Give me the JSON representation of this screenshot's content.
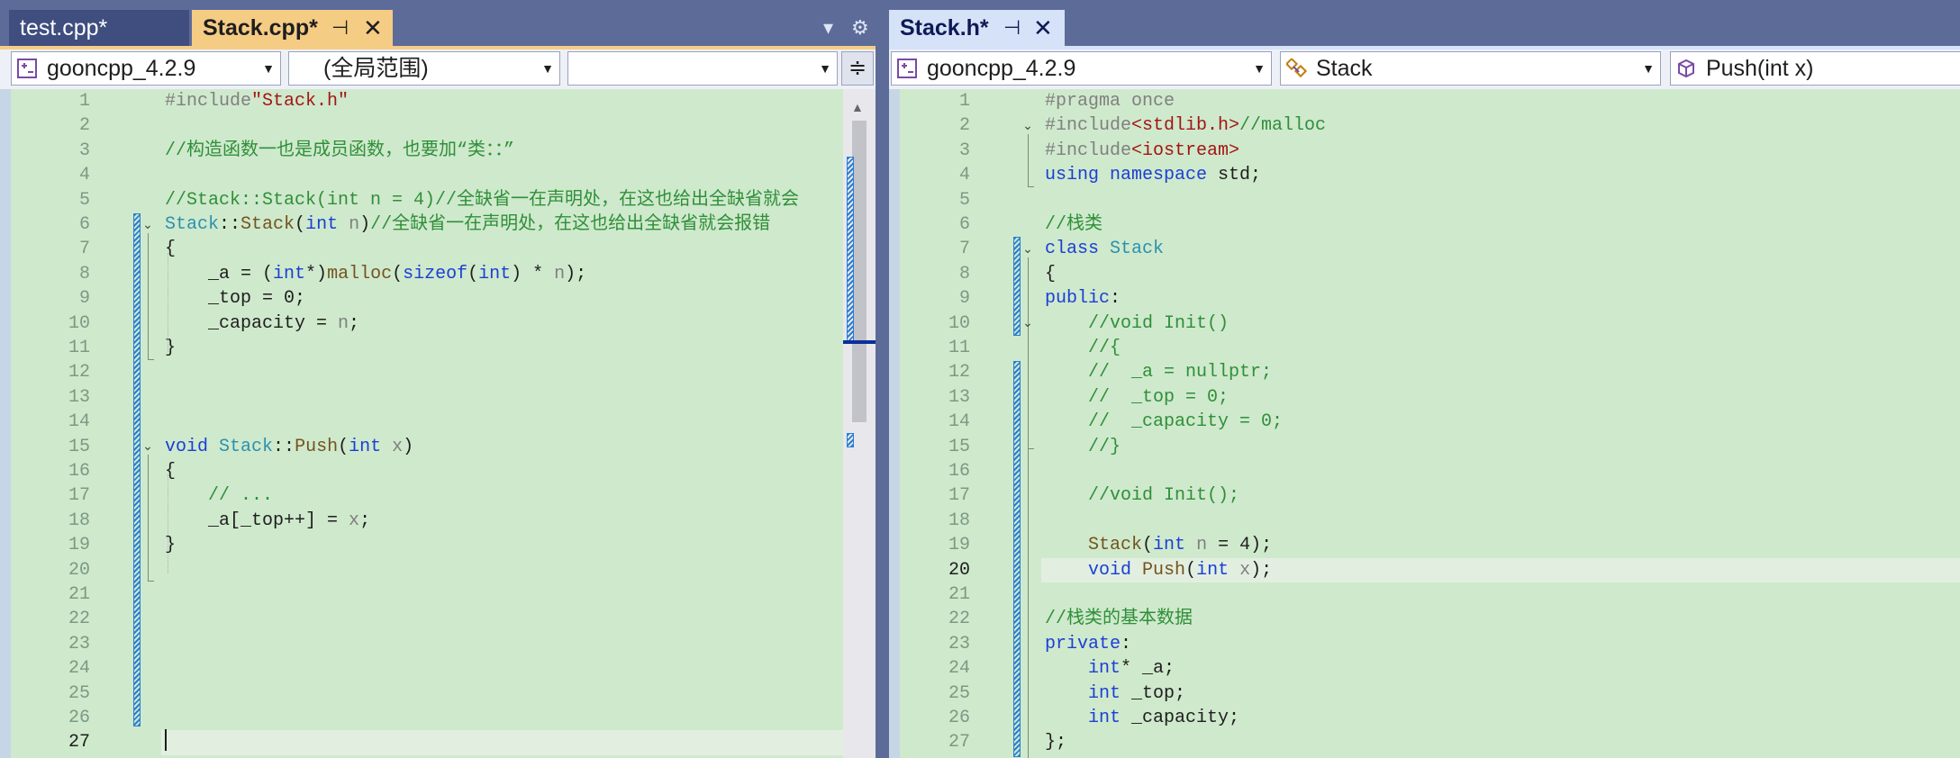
{
  "left": {
    "tabs": [
      {
        "label": "test.cpp*"
      },
      {
        "label": "Stack.cpp*",
        "active": true
      }
    ],
    "tab_pin": "⊣",
    "tab_close": "✕",
    "dropdown_icon": "chevron-down-icon",
    "settings_icon": "gear-icon",
    "nav": {
      "project": "gooncpp_4.2.9",
      "scope": "(全局范围)",
      "member": ""
    },
    "lines": [
      {
        "n": "1",
        "code": [
          [
            "pp",
            "#include"
          ],
          [
            "st",
            "\"Stack.h\""
          ]
        ]
      },
      {
        "n": "2",
        "code": []
      },
      {
        "n": "3",
        "code": [
          [
            "cm",
            "//构造函数一也是成员函数，也要加“类：：”"
          ]
        ]
      },
      {
        "n": "4",
        "code": []
      },
      {
        "n": "5",
        "code": [
          [
            "cm",
            "//Stack::Stack(int n = 4)//全缺省一在声明处，在这也给出全缺省就会"
          ]
        ]
      },
      {
        "n": "6",
        "code": [
          [
            "ty",
            "Stack"
          ],
          [
            "",
            "::"
          ],
          [
            "fn",
            "Stack"
          ],
          [
            "",
            "("
          ],
          [
            "kw",
            "int"
          ],
          [
            "",
            ""
          ],
          [
            "pa",
            " n"
          ],
          [
            "",
            ")"
          ],
          [
            "cm",
            "//全缺省一在声明处，在这也给出全缺省就会报错"
          ]
        ]
      },
      {
        "n": "7",
        "code": [
          [
            "",
            "{"
          ]
        ]
      },
      {
        "n": "8",
        "code": [
          [
            "",
            "    _a = ("
          ],
          [
            "kw",
            "int"
          ],
          [
            "",
            "*)"
          ],
          [
            "fn",
            "malloc"
          ],
          [
            "",
            "("
          ],
          [
            "kw",
            "sizeof"
          ],
          [
            "",
            "("
          ],
          [
            "kw",
            "int"
          ],
          [
            "",
            ") * "
          ],
          [
            "pa",
            "n"
          ],
          [
            "",
            ");"
          ]
        ]
      },
      {
        "n": "9",
        "code": [
          [
            "",
            "    _top = 0;"
          ]
        ]
      },
      {
        "n": "10",
        "code": [
          [
            "",
            "    _capacity = "
          ],
          [
            "pa",
            "n"
          ],
          [
            "",
            ";"
          ]
        ]
      },
      {
        "n": "11",
        "code": [
          [
            "",
            "}"
          ]
        ]
      },
      {
        "n": "12",
        "code": []
      },
      {
        "n": "13",
        "code": []
      },
      {
        "n": "14",
        "code": []
      },
      {
        "n": "15",
        "code": [
          [
            "kw",
            "void"
          ],
          [
            "",
            " "
          ],
          [
            "ty",
            "Stack"
          ],
          [
            "",
            "::"
          ],
          [
            "fn",
            "Push"
          ],
          [
            "",
            "("
          ],
          [
            "kw",
            "int"
          ],
          [
            "pa",
            " x"
          ],
          [
            "",
            ")"
          ]
        ]
      },
      {
        "n": "16",
        "code": [
          [
            "",
            "{"
          ]
        ]
      },
      {
        "n": "17",
        "code": [
          [
            "cm",
            "    // ..."
          ]
        ]
      },
      {
        "n": "18",
        "code": [
          [
            "",
            "    _a[_top++] = "
          ],
          [
            "pa",
            "x"
          ],
          [
            "",
            ";"
          ]
        ]
      },
      {
        "n": "19",
        "code": [
          [
            "",
            "}"
          ]
        ]
      },
      {
        "n": "20",
        "code": []
      },
      {
        "n": "21",
        "code": []
      },
      {
        "n": "22",
        "code": []
      },
      {
        "n": "23",
        "code": []
      },
      {
        "n": "24",
        "code": []
      },
      {
        "n": "25",
        "code": []
      },
      {
        "n": "26",
        "code": []
      },
      {
        "n": "27",
        "code": [],
        "current": true
      }
    ]
  },
  "right": {
    "tabs": [
      {
        "label": "Stack.h*",
        "active": true
      }
    ],
    "tab_pin": "⊣",
    "tab_close": "✕",
    "nav": {
      "project": "gooncpp_4.2.9",
      "scope": "Stack",
      "member": "Push(int x)"
    },
    "lines": [
      {
        "n": "1",
        "code": [
          [
            "pp",
            "#pragma once"
          ]
        ]
      },
      {
        "n": "2",
        "code": [
          [
            "pp",
            "#include"
          ],
          [
            "st",
            "<stdlib.h>"
          ],
          [
            "cm",
            "//malloc"
          ]
        ]
      },
      {
        "n": "3",
        "code": [
          [
            "pp",
            "#include"
          ],
          [
            "st",
            "<iostream>"
          ]
        ]
      },
      {
        "n": "4",
        "code": [
          [
            "kw",
            "using namespace"
          ],
          [
            "",
            " std;"
          ]
        ]
      },
      {
        "n": "5",
        "code": []
      },
      {
        "n": "6",
        "code": [
          [
            "cm",
            "//栈类"
          ]
        ]
      },
      {
        "n": "7",
        "code": [
          [
            "kw",
            "class"
          ],
          [
            "",
            " "
          ],
          [
            "ty",
            "Stack"
          ]
        ]
      },
      {
        "n": "8",
        "code": [
          [
            "",
            "{"
          ]
        ]
      },
      {
        "n": "9",
        "code": [
          [
            "kw",
            "public"
          ],
          [
            "",
            ":"
          ]
        ]
      },
      {
        "n": "10",
        "code": [
          [
            "cm",
            "    //void Init()"
          ]
        ]
      },
      {
        "n": "11",
        "code": [
          [
            "cm",
            "    //{"
          ]
        ]
      },
      {
        "n": "12",
        "code": [
          [
            "cm",
            "    //  _a = nullptr;"
          ]
        ]
      },
      {
        "n": "13",
        "code": [
          [
            "cm",
            "    //  _top = 0;"
          ]
        ]
      },
      {
        "n": "14",
        "code": [
          [
            "cm",
            "    //  _capacity = 0;"
          ]
        ]
      },
      {
        "n": "15",
        "code": [
          [
            "cm",
            "    //}"
          ]
        ]
      },
      {
        "n": "16",
        "code": []
      },
      {
        "n": "17",
        "code": [
          [
            "cm",
            "    //void Init();"
          ]
        ]
      },
      {
        "n": "18",
        "code": []
      },
      {
        "n": "19",
        "code": [
          [
            "",
            "    "
          ],
          [
            "fn",
            "Stack"
          ],
          [
            "",
            "("
          ],
          [
            "kw",
            "int"
          ],
          [
            "pa",
            " n"
          ],
          [
            "",
            " = 4);"
          ]
        ]
      },
      {
        "n": "20",
        "code": [
          [
            "",
            "    "
          ],
          [
            "kw",
            "void"
          ],
          [
            "",
            " "
          ],
          [
            "fn",
            "Push"
          ],
          [
            "",
            "("
          ],
          [
            "kw",
            "int"
          ],
          [
            "pa",
            " x"
          ],
          [
            "",
            ");"
          ]
        ],
        "current": true
      },
      {
        "n": "21",
        "code": []
      },
      {
        "n": "22",
        "code": [
          [
            "cm",
            "//栈类的基本数据"
          ]
        ]
      },
      {
        "n": "23",
        "code": [
          [
            "kw",
            "private"
          ],
          [
            "",
            ":"
          ]
        ]
      },
      {
        "n": "24",
        "code": [
          [
            "",
            "    "
          ],
          [
            "kw",
            "int"
          ],
          [
            "",
            "* _a;"
          ]
        ]
      },
      {
        "n": "25",
        "code": [
          [
            "",
            "    "
          ],
          [
            "kw",
            "int"
          ],
          [
            "",
            " _top;"
          ]
        ]
      },
      {
        "n": "26",
        "code": [
          [
            "",
            "    "
          ],
          [
            "kw",
            "int"
          ],
          [
            "",
            " _capacity;"
          ]
        ]
      },
      {
        "n": "27",
        "code": [
          [
            "",
            "};"
          ]
        ]
      }
    ]
  }
}
